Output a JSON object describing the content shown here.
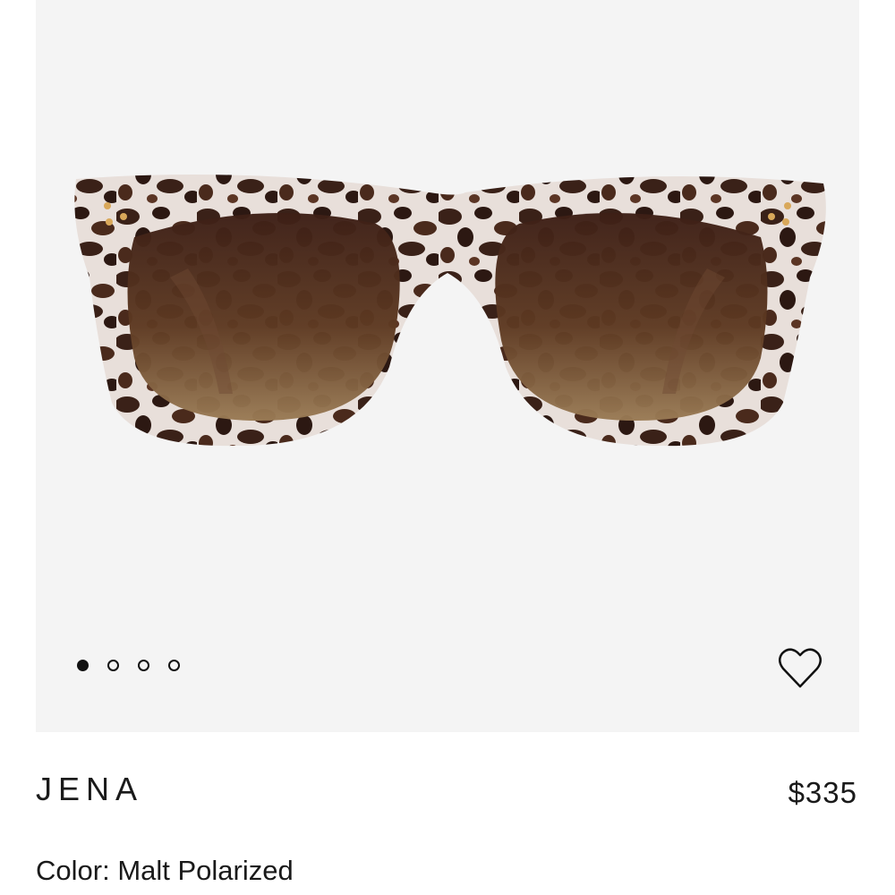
{
  "product": {
    "name": "JENA",
    "price": "$335",
    "color_label": "Color:",
    "color_value": "Malt Polarized"
  },
  "gallery": {
    "slides": 4,
    "active_index": 0,
    "image_icon": "sunglasses-tortoise-image"
  },
  "wishlist": {
    "icon": "heart-outline-icon"
  },
  "colors": {
    "media_background": "#f4f4f4",
    "frame_light": "#e6dcd6",
    "frame_dark": "#3a2118",
    "lens_top": "#3d1f16",
    "lens_bottom": "#8a6a46",
    "stud": "#d9a85a"
  }
}
